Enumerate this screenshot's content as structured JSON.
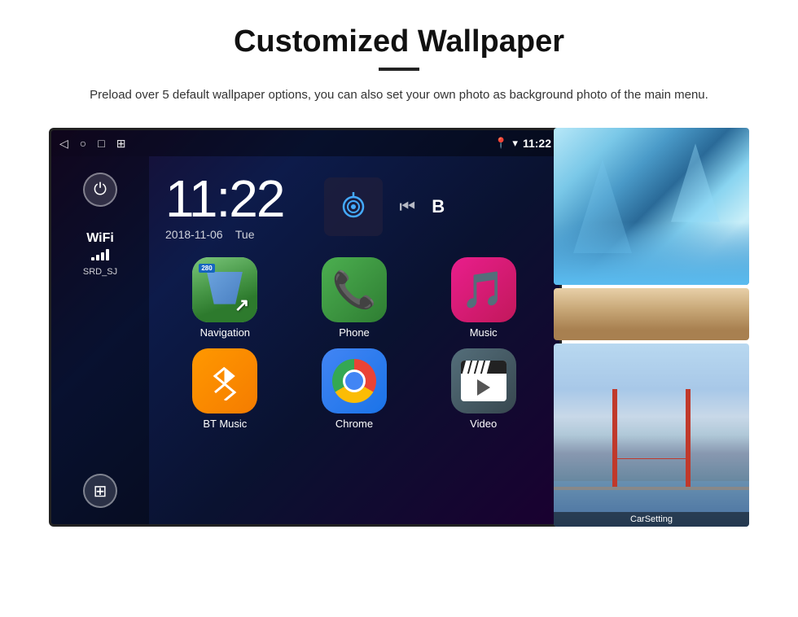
{
  "page": {
    "title": "Customized Wallpaper",
    "divider": true,
    "subtitle": "Preload over 5 default wallpaper options, you can also set your own photo as background photo of the main menu."
  },
  "statusbar": {
    "back_icon": "◁",
    "home_icon": "○",
    "square_icon": "□",
    "screenshot_icon": "⊞",
    "location_icon": "▼",
    "wifi_icon": "▾",
    "time": "11:22"
  },
  "sidebar": {
    "power_icon": "⏻",
    "wifi_label": "WiFi",
    "ssid": "SRD_SJ",
    "apps_icon": "⊞"
  },
  "clock": {
    "time": "11:22",
    "date": "2018-11-06",
    "day": "Tue"
  },
  "apps": [
    {
      "id": "navigation",
      "label": "Navigation",
      "type": "navigation"
    },
    {
      "id": "phone",
      "label": "Phone",
      "type": "phone"
    },
    {
      "id": "music",
      "label": "Music",
      "type": "music"
    },
    {
      "id": "btmusic",
      "label": "BT Music",
      "type": "btmusic"
    },
    {
      "id": "chrome",
      "label": "Chrome",
      "type": "chrome"
    },
    {
      "id": "video",
      "label": "Video",
      "type": "video"
    }
  ],
  "wallpapers": [
    {
      "id": "ice-cave",
      "label": "Ice Cave"
    },
    {
      "id": "desert",
      "label": "Desert"
    },
    {
      "id": "bridge",
      "label": "CarSetting"
    }
  ],
  "nav_badge": "280"
}
